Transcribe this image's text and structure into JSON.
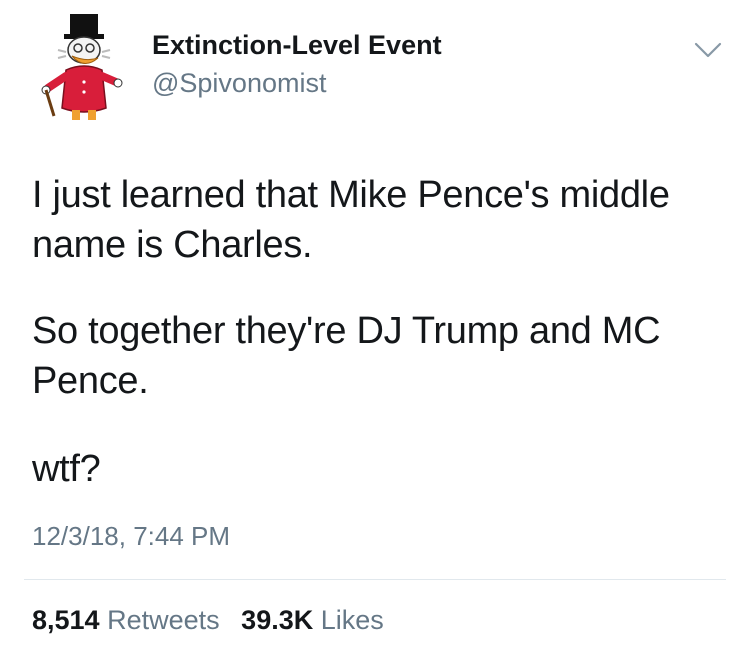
{
  "user": {
    "display_name": "Extinction-Level Event",
    "handle": "@Spivonomist",
    "avatar_icon": "cartoon-duck-avatar-icon"
  },
  "tweet": {
    "paragraphs": [
      "I just learned that Mike Pence's middle name is Charles.",
      "So together they're DJ Trump and MC Pence.",
      "wtf?"
    ],
    "timestamp": "12/3/18, 7:44 PM"
  },
  "stats": {
    "retweets_count": "8,514",
    "retweets_label": "Retweets",
    "likes_count": "39.3K",
    "likes_label": "Likes"
  },
  "menu": {
    "icon": "chevron-down-icon"
  },
  "colors": {
    "primary_text": "#14171a",
    "secondary_text": "#657786",
    "divider": "#e1e8ed",
    "background": "#ffffff"
  }
}
